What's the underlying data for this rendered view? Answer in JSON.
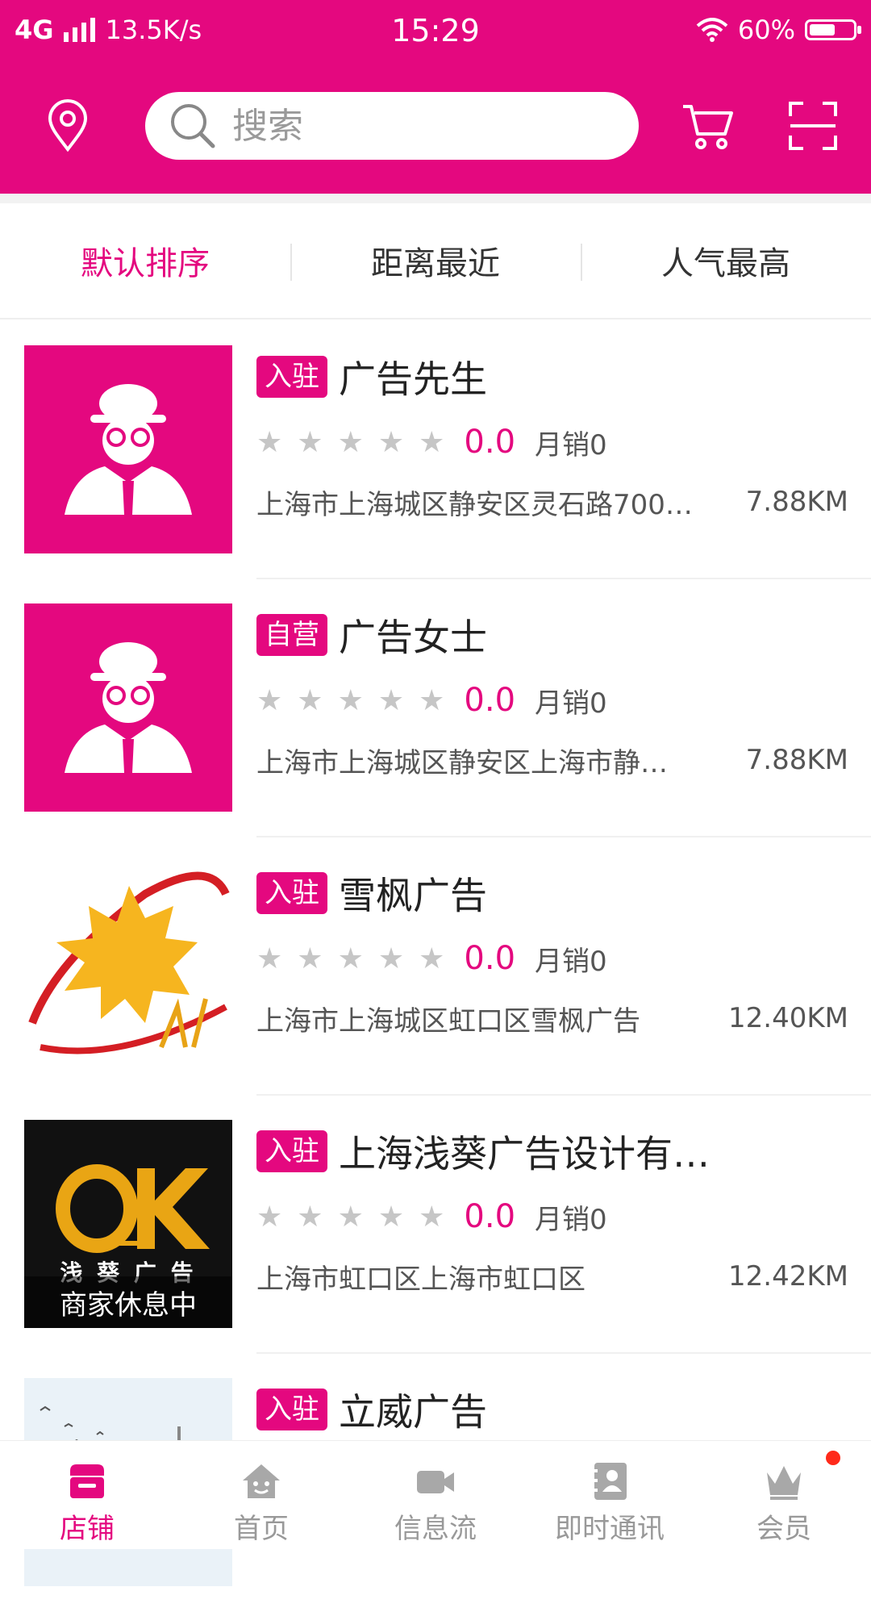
{
  "status_bar": {
    "network": "4G",
    "speed": "13.5K/s",
    "time": "15:29",
    "battery_text": "60%",
    "battery_level": 0.6
  },
  "header": {
    "search_placeholder": "搜索"
  },
  "sort_tabs": [
    {
      "label": "默认排序",
      "active": true
    },
    {
      "label": "距离最近",
      "active": false
    },
    {
      "label": "人气最高",
      "active": false
    }
  ],
  "stores": [
    {
      "tag": "入驻",
      "name": "广告先生",
      "score": "0.0",
      "sales": "月销0",
      "address": "上海市上海城区静安区灵石路700…",
      "distance": "7.88KM",
      "stars": 0
    },
    {
      "tag": "自营",
      "name": "广告女士",
      "score": "0.0",
      "sales": "月销0",
      "address": "上海市上海城区静安区上海市静…",
      "distance": "7.88KM",
      "stars": 0
    },
    {
      "tag": "入驻",
      "name": "雪枫广告",
      "score": "0.0",
      "sales": "月销0",
      "address": "上海市上海城区虹口区雪枫广告",
      "distance": "12.40KM",
      "stars": 0
    },
    {
      "tag": "入驻",
      "name": "上海浅葵广告设计有…",
      "score": "0.0",
      "sales": "月销0",
      "address": "上海市虹口区上海市虹口区",
      "distance": "12.42KM",
      "stars": 0,
      "logo_text": "浅 葵 广 告",
      "status_overlay": "商家休息中"
    },
    {
      "tag": "入驻",
      "name": "立威广告"
    }
  ],
  "tabbar": [
    {
      "label": "店铺",
      "icon": "store-icon",
      "active": true
    },
    {
      "label": "首页",
      "icon": "home-icon",
      "active": false
    },
    {
      "label": "信息流",
      "icon": "video-icon",
      "active": false
    },
    {
      "label": "即时通讯",
      "icon": "contacts-icon",
      "active": false
    },
    {
      "label": "会员",
      "icon": "crown-icon",
      "active": false,
      "badge": true
    }
  ],
  "colors": {
    "brand": "#E4087F",
    "star_empty": "#c6c6c6",
    "badge_red": "#ff2a1a"
  }
}
